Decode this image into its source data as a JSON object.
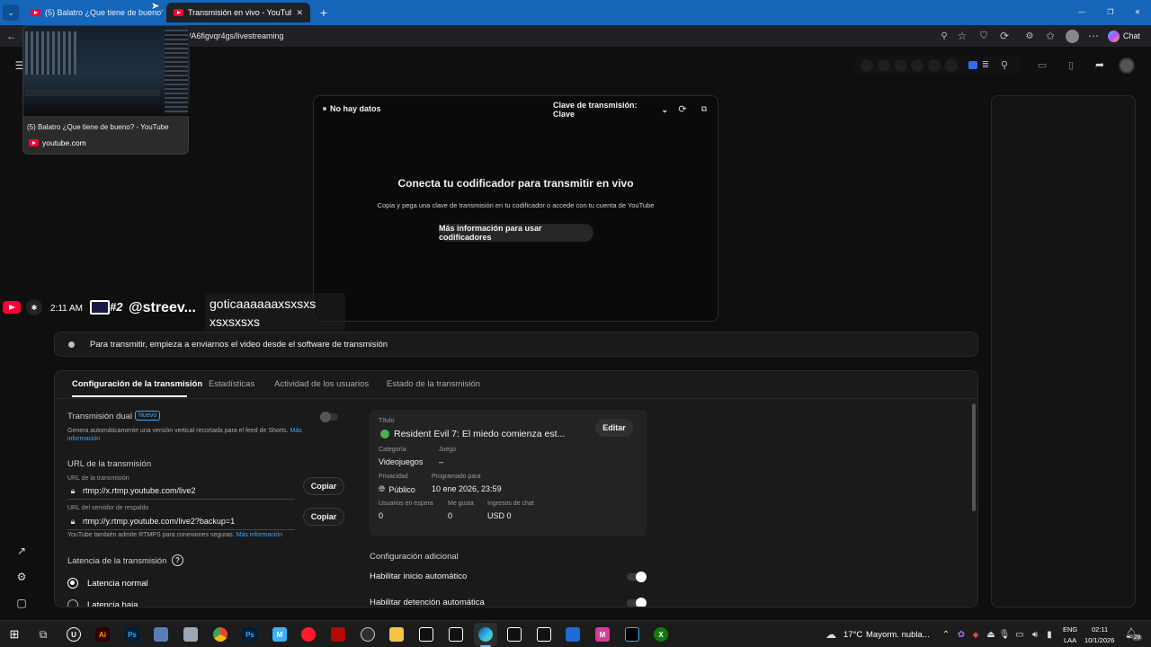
{
  "browser": {
    "tabs": [
      {
        "title": "(5) Balatro ¿Que tiene de bueno?",
        "active": false
      },
      {
        "title": "Transmisión en vivo - YouTube Stu",
        "active": true
      }
    ],
    "new_tab": "+",
    "url": "/A6figvqr4gs/livestreaming",
    "chat_label": "Chat",
    "window_controls": [
      "—",
      "❐",
      "✕"
    ]
  },
  "tab_preview": {
    "title": "(5) Balatro ¿Que tiene de bueno? - YouTube",
    "domain": "youtube.com"
  },
  "preview": {
    "status": "No hay datos",
    "key_select": "Clave de transmisión: Clave",
    "heading": "Conecta tu codificador para transmitir en vivo",
    "description": "Copia y pega una clave de transmisión en tu codificador o accede con tu cuenta de YouTube",
    "more_info_button": "Más información para usar codificadores"
  },
  "overlay": {
    "time": "2:11 AM",
    "rank": "#2",
    "handle": "@streev...",
    "message_line1": "goticaaaaaaxsxsxs",
    "message_line2": "xsxsxsxs"
  },
  "status_bar": {
    "text": "Para transmitir, empieza a enviarnos el video desde el software de transmisión"
  },
  "tabs": [
    {
      "label": "Configuración de la transmisión",
      "active": true
    },
    {
      "label": "Estadísticas",
      "active": false
    },
    {
      "label": "Actividad de los usuarios",
      "active": false
    },
    {
      "label": "Estado de la transmisión",
      "active": false
    }
  ],
  "settings": {
    "dual_title": "Transmisión dual",
    "dual_badge": "Nuevo",
    "dual_desc": "Genera automáticamente una versión vertical recortada para el feed de Shorts.",
    "dual_link_1": "Más",
    "dual_link_2": "información",
    "url_section": "URL de la transmisión",
    "url_label": "URL de la transmisión",
    "url_value": "rtmp://x.rtmp.youtube.com/live2",
    "backup_label": "URL del servidor de respaldo",
    "backup_value": "rtmp://y.rtmp.youtube.com/live2?backup=1",
    "copy_label": "Copiar",
    "rtmps_note": "YouTube también admite RTMPS para conexiones seguras.",
    "rtmps_link": "Más información",
    "latency_title": "Latencia de la transmisión",
    "latency_help": "?",
    "latency_options": [
      {
        "label": "Latencia normal",
        "selected": true
      },
      {
        "label": "Latencia baja",
        "selected": false
      }
    ]
  },
  "details": {
    "title_label": "Título",
    "title_value": "Resident Evil 7: El miedo comienza est...",
    "edit_button": "Editar",
    "category_label": "Categoría",
    "category_value": "Videojuegos",
    "game_label": "Juego",
    "game_value": "–",
    "privacy_label": "Privacidad",
    "privacy_value": "Público",
    "scheduled_label": "Programado para",
    "scheduled_value": "10 ene 2026, 23:59",
    "waiting_label": "Usuarios en espera",
    "waiting_value": "0",
    "likes_label": "Me gusta",
    "likes_value": "0",
    "chat_income_label": "Ingresos de chat",
    "chat_income_value": "USD 0"
  },
  "additional": {
    "title": "Configuración adicional",
    "auto_start": "Habilitar inicio automático",
    "auto_stop": "Habilitar detención automática"
  },
  "taskbar": {
    "weather_temp": "17°C",
    "weather_desc": "Mayorm. nubla...",
    "lang_1": "ENG",
    "lang_2": "LAA",
    "time": "02:11",
    "date": "10/1/2026",
    "notif_count": "29",
    "apps": [
      "U",
      "Ai",
      "Ps",
      "Ps",
      "M",
      "M",
      "X"
    ]
  },
  "colors": {
    "accent_blue": "#3ea6ff",
    "youtube_red": "#ff0033",
    "browser_tab_bar": "#1565b8"
  }
}
